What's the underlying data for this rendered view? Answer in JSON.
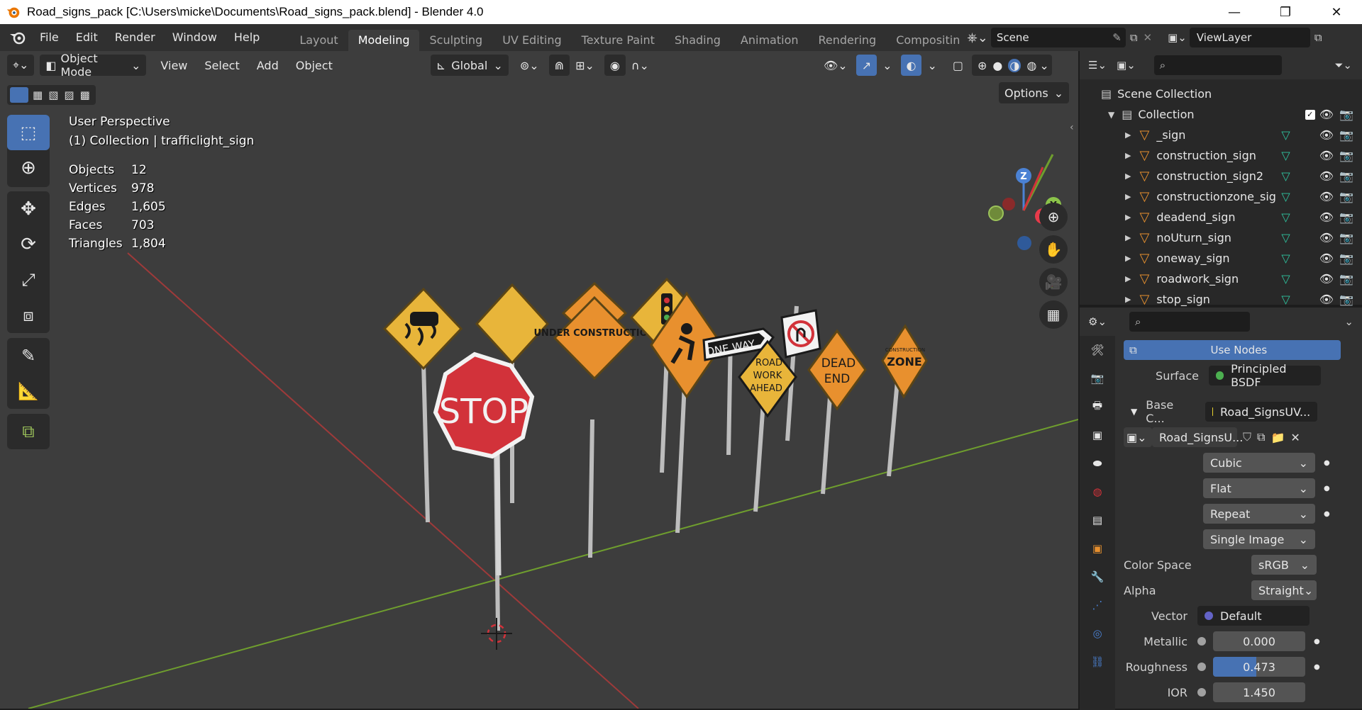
{
  "window": {
    "title": "Road_signs_pack [C:\\Users\\micke\\Documents\\Road_signs_pack.blend] - Blender 4.0",
    "minimize": "—",
    "maximize": "❐",
    "close": "✕"
  },
  "menu": [
    "File",
    "Edit",
    "Render",
    "Window",
    "Help"
  ],
  "workspaces": [
    {
      "label": "Layout",
      "active": false
    },
    {
      "label": "Modeling",
      "active": true
    },
    {
      "label": "Sculpting",
      "active": false
    },
    {
      "label": "UV Editing",
      "active": false
    },
    {
      "label": "Texture Paint",
      "active": false
    },
    {
      "label": "Shading",
      "active": false
    },
    {
      "label": "Animation",
      "active": false
    },
    {
      "label": "Rendering",
      "active": false
    },
    {
      "label": "Compositin",
      "active": false
    }
  ],
  "scene": {
    "label": "Scene"
  },
  "view_layer": {
    "label": "ViewLayer"
  },
  "viewport_header": {
    "mode": "Object Mode",
    "view": "View",
    "select": "Select",
    "add": "Add",
    "object": "Object",
    "transform_orientation": "Global",
    "options": "Options"
  },
  "overlay": {
    "perspective": "User Perspective",
    "context": "(1) Collection | trafficlight_sign",
    "stats": [
      {
        "key": "Objects",
        "value": "12"
      },
      {
        "key": "Vertices",
        "value": "978"
      },
      {
        "key": "Edges",
        "value": "1,605"
      },
      {
        "key": "Faces",
        "value": "703"
      },
      {
        "key": "Triangles",
        "value": "1,804"
      }
    ]
  },
  "gizmo": {
    "z": "Z",
    "y": "Y",
    "x": "X"
  },
  "signs": {
    "stop": "STOP",
    "under_construction": "UNDER CONSTRUCTION",
    "one_way": "ONE WAY",
    "road_work": [
      "ROAD",
      "WORK",
      "AHEAD"
    ],
    "dead_end": [
      "DEAD",
      "END"
    ],
    "construction_zone": [
      "CONSTRUCTION",
      "ZONE"
    ]
  },
  "outliner": {
    "scene_collection": "Scene Collection",
    "collection": "Collection",
    "items": [
      "_sign",
      "construction_sign",
      "construction_sign2",
      "constructionzone_sigr",
      "deadend_sign",
      "noUturn_sign",
      "oneway_sign",
      "roadwork_sign",
      "stop_sign"
    ]
  },
  "properties": {
    "use_nodes": "Use Nodes",
    "surface_label": "Surface",
    "surface_value": "Principled BSDF",
    "base_color_label": "Base C...",
    "base_color_value": "Road_SignsUV...",
    "image_name": "Road_SignsU...",
    "interpolation": "Cubic",
    "projection": "Flat",
    "extension": "Repeat",
    "source": "Single Image",
    "color_space_label": "Color Space",
    "color_space_value": "sRGB",
    "alpha_label": "Alpha",
    "alpha_value": "Straight",
    "vector_label": "Vector",
    "vector_value": "Default",
    "metallic_label": "Metallic",
    "metallic_value": "0.000",
    "roughness_label": "Roughness",
    "roughness_value": "0.473",
    "roughness_fraction": 0.473,
    "ior_label": "IOR",
    "ior_value": "1.450"
  },
  "colors": {
    "accent": "#4772b3",
    "sign_yellow": "#e8b53a",
    "sign_orange": "#e8902e",
    "stop_red": "#d2323a",
    "grid_x": "#9e3a3a",
    "grid_y": "#6f9e2e"
  }
}
